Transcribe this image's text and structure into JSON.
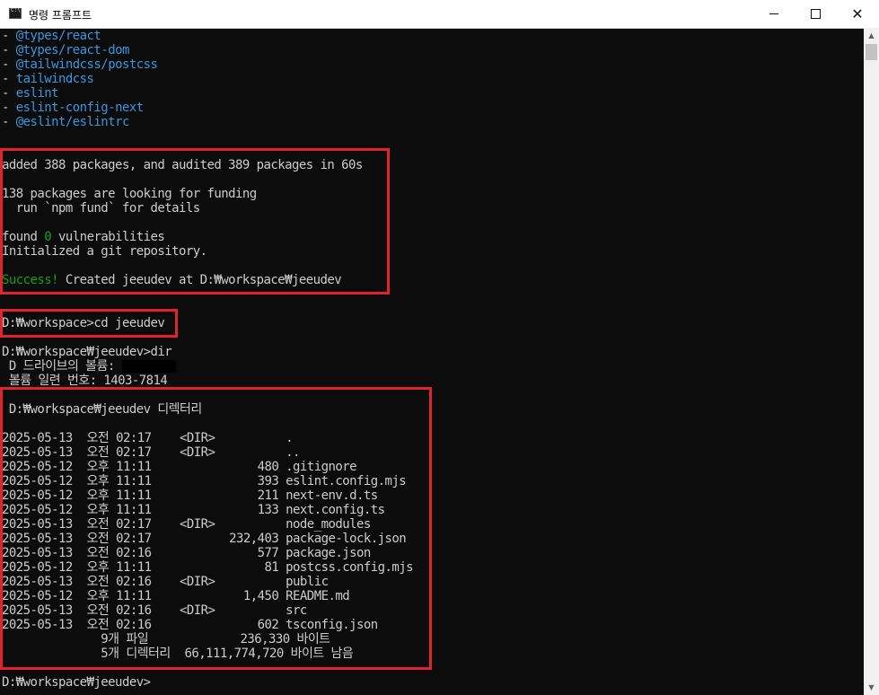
{
  "window": {
    "title": "명령 프롬프트",
    "minimize_icon": "minimize-icon",
    "maximize_icon": "maximize-icon",
    "close_icon": "close-icon"
  },
  "colors": {
    "background": "#0c0c0c",
    "text": "#cccccc",
    "dependency": "#3a96dd",
    "success": "#13a10e",
    "highlight_box": "#e0242d"
  },
  "console": {
    "dependencies": [
      "@types/react",
      "@types/react-dom",
      "@tailwindcss/postcss",
      "tailwindcss",
      "eslint",
      "eslint-config-next",
      "@eslint/eslintrc"
    ],
    "dependency_bullet": "- ",
    "install": {
      "added": "added 388 packages, and audited 389 packages in 60s",
      "funding": "138 packages are looking for funding",
      "fund_hint": "  run `npm fund` for details",
      "vuln_prefix": "found ",
      "vuln_count": "0",
      "vuln_suffix": " vulnerabilities",
      "git": "Initialized a git repository.",
      "success_word": "Success!",
      "success_rest": " Created jeeudev at D:₩workspace₩jeeudev"
    },
    "cd_command": "D:₩workspace>cd jeeudev",
    "dir_command": "D:₩workspace₩jeeudev>dir",
    "volume_line": " D 드라이브의 볼륨: ",
    "serial_line": " 볼륨 일련 번호: 1403-7814",
    "dir_header": " D:₩workspace₩jeeudev 디렉터리",
    "dir_entries": [
      "2025-05-13  오전 02:17    <DIR>          .",
      "2025-05-13  오전 02:17    <DIR>          ..",
      "2025-05-12  오후 11:11               480 .gitignore",
      "2025-05-12  오후 11:11               393 eslint.config.mjs",
      "2025-05-12  오후 11:11               211 next-env.d.ts",
      "2025-05-12  오후 11:11               133 next.config.ts",
      "2025-05-13  오전 02:17    <DIR>          node_modules",
      "2025-05-13  오전 02:17           232,403 package-lock.json",
      "2025-05-13  오전 02:16               577 package.json",
      "2025-05-12  오후 11:11                81 postcss.config.mjs",
      "2025-05-13  오전 02:16    <DIR>          public",
      "2025-05-12  오후 11:11             1,450 README.md",
      "2025-05-13  오전 02:16    <DIR>          src",
      "2025-05-13  오전 02:16               602 tsconfig.json"
    ],
    "files_summary": "              9개 파일             236,330 바이트",
    "dirs_summary": "              5개 디렉터리  66,111,774,720 바이트 남음",
    "prompt": "D:₩workspace₩jeeudev>"
  }
}
